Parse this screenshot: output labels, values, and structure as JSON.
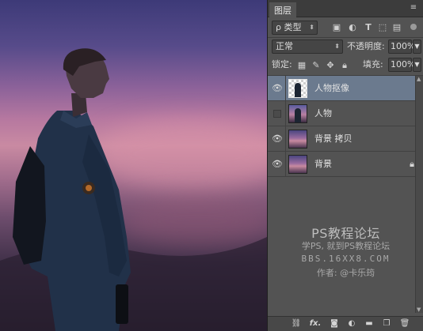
{
  "panel": {
    "tab_label": "图层",
    "menu_icon": "panel-menu-icon",
    "filter": {
      "label": "ρ 类型",
      "icons": [
        "image-filter-icon",
        "adjustment-filter-icon",
        "type-filter-icon",
        "shape-filter-icon",
        "smart-object-filter-icon"
      ]
    },
    "blend_mode": "正常",
    "opacity_label": "不透明度:",
    "opacity_value": "100%",
    "lock_label": "锁定:",
    "fill_label": "填充:",
    "fill_value": "100%"
  },
  "layers": [
    {
      "name": "人物抠像",
      "visible": true,
      "selected": true,
      "thumbnail": "transparent-figure",
      "locked": false
    },
    {
      "name": "人物",
      "visible": false,
      "selected": false,
      "thumbnail": "photo-figure",
      "locked": false
    },
    {
      "name": "背景 拷贝",
      "visible": true,
      "selected": false,
      "thumbnail": "dusk-sky",
      "locked": false
    },
    {
      "name": "背景",
      "visible": true,
      "selected": false,
      "thumbnail": "dusk-sky",
      "locked": true
    }
  ],
  "watermark": {
    "line1": "PS教程论坛",
    "line2": "学PS, 就到PS教程论坛",
    "line3": "BBS.16XX8.COM",
    "line4": "作者: @卡乐筠"
  },
  "bottom_icons": [
    "link-layers-icon",
    "fx-icon",
    "add-mask-icon",
    "adjustment-layer-icon",
    "new-group-icon",
    "new-layer-icon",
    "delete-layer-icon"
  ],
  "bottom_fx_label": "fx.",
  "colors": {
    "panel_bg": "#535353",
    "selected_row": "#6b7a8e",
    "tab_bar": "#3c3c3c"
  }
}
